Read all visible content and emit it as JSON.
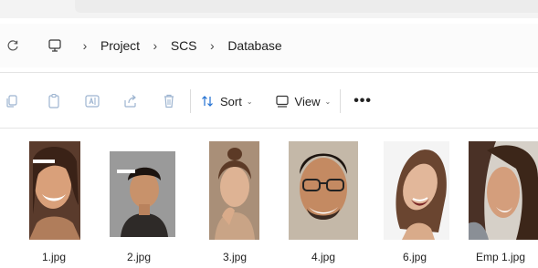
{
  "breadcrumb": {
    "items": [
      "Project",
      "SCS",
      "Database"
    ],
    "separator": "›"
  },
  "toolbar": {
    "sort_label": "Sort",
    "view_label": "View",
    "more_label": "•••"
  },
  "files": [
    {
      "name": "1.jpg"
    },
    {
      "name": "2.jpg"
    },
    {
      "name": "3.jpg"
    },
    {
      "name": "4.jpg"
    },
    {
      "name": "6.jpg"
    },
    {
      "name": "Emp 1.jpg"
    }
  ],
  "colors": {
    "icon_disabled": "#9db4d0",
    "accent": "#1f6fd1",
    "text": "#1f1f1f"
  },
  "icons": [
    "refresh-icon",
    "monitor-icon",
    "copy-icon",
    "paste-icon",
    "rename-icon",
    "share-icon",
    "delete-icon",
    "sort-icon",
    "view-icon",
    "more-icon"
  ]
}
